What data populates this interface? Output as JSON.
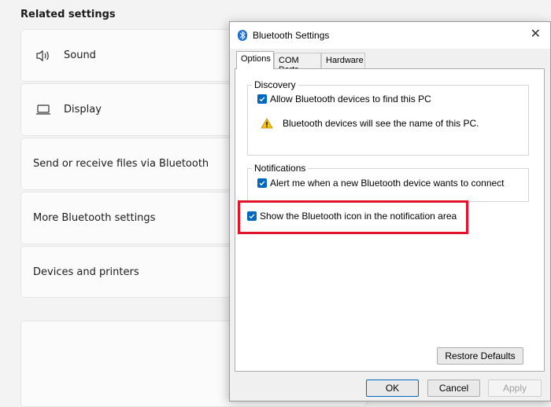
{
  "related_settings": {
    "title": "Related settings",
    "items": [
      {
        "label": "Sound",
        "icon": "speaker-icon"
      },
      {
        "label": "Display",
        "icon": "monitor-icon"
      },
      {
        "label": "Send or receive files via Bluetooth"
      },
      {
        "label": "More Bluetooth settings"
      },
      {
        "label": "Devices and printers"
      }
    ]
  },
  "dialog": {
    "title": "Bluetooth Settings",
    "close_icon": "close-icon",
    "tabs": [
      "Options",
      "COM Ports",
      "Hardware"
    ],
    "active_tab": "Options",
    "discovery": {
      "legend": "Discovery",
      "checkbox_label": "Allow Bluetooth devices to find this PC",
      "checked": true,
      "warning_text": "Bluetooth devices will see the name of this PC."
    },
    "notifications": {
      "legend": "Notifications",
      "checkbox_label": "Alert me when a new Bluetooth device wants to connect",
      "checked": true
    },
    "show_icon": {
      "checkbox_label": "Show the Bluetooth icon in the notification area",
      "checked": true
    },
    "restore_defaults": "Restore Defaults",
    "ok": "OK",
    "cancel": "Cancel",
    "apply": "Apply"
  },
  "colors": {
    "accent": "#0067c0",
    "highlight_border": "#e2132b",
    "warning_yellow": "#f5c211"
  }
}
